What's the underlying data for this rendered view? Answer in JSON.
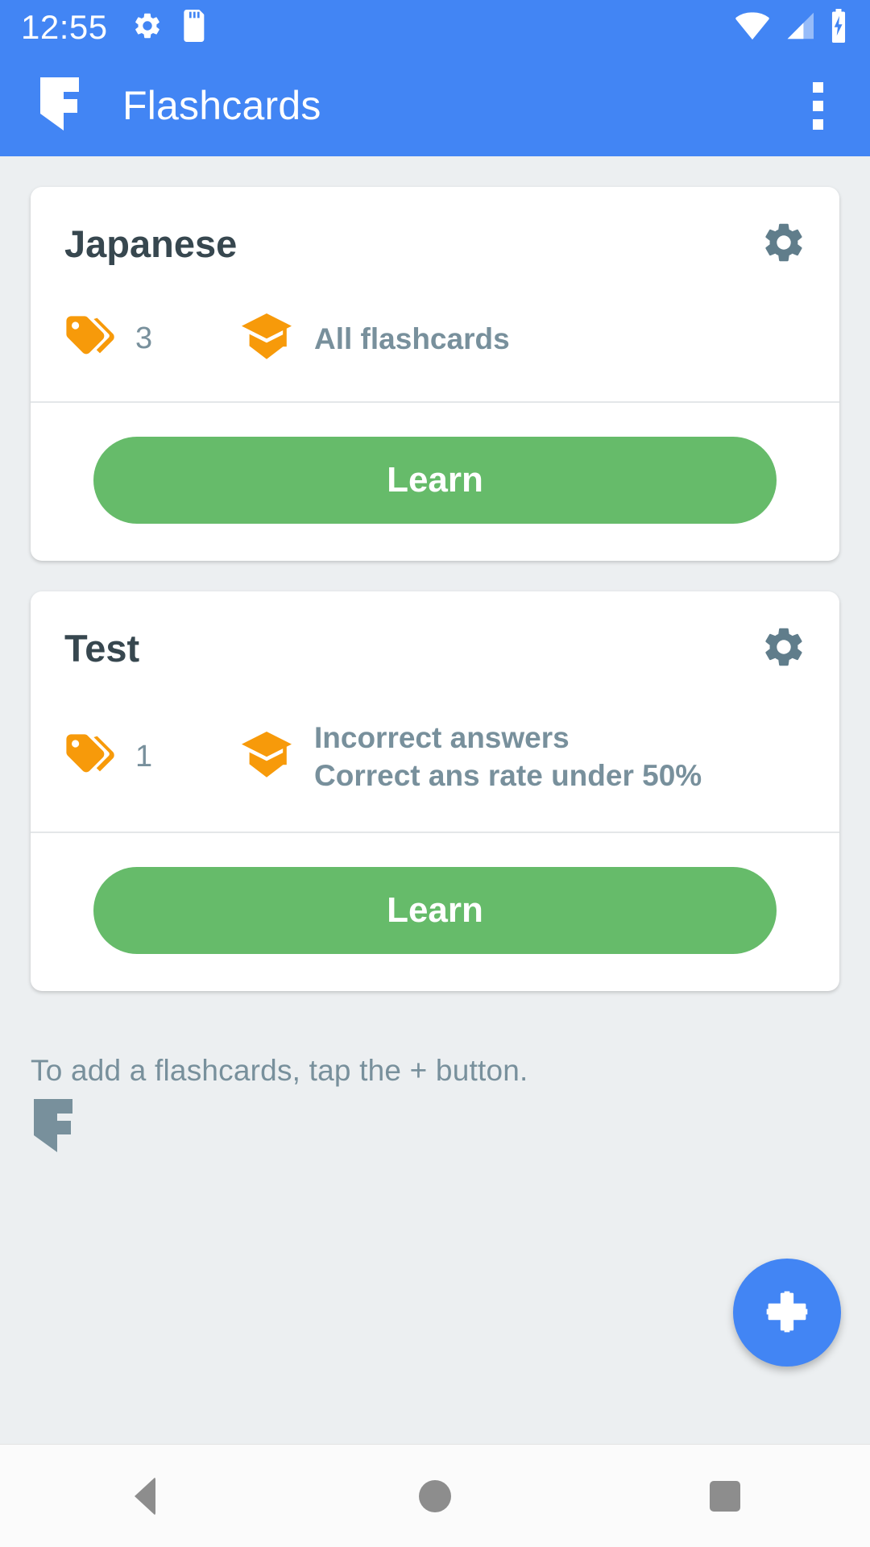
{
  "status_bar": {
    "time": "12:55",
    "left_icons": [
      "gear-icon",
      "sd-card-icon"
    ],
    "right_icons": [
      "wifi-icon",
      "cell-signal-icon",
      "battery-charging-icon"
    ]
  },
  "app_bar": {
    "logo": "flashcards-logo",
    "title": "Flashcards",
    "overflow": "overflow-menu-icon"
  },
  "colors": {
    "primary": "#4285f4",
    "learn_button": "#66bb6a",
    "accent_orange": "#f79a0a",
    "text_muted": "#78909c",
    "title": "#37474f",
    "background": "#eceff1"
  },
  "cards": [
    {
      "title": "Japanese",
      "gear": "settings-gear-icon",
      "tag_icon": "tags-icon",
      "tag_count": "3",
      "mode_icon": "graduation-cap-icon",
      "mode_lines": [
        "All flashcards"
      ],
      "learn_label": "Learn"
    },
    {
      "title": "Test",
      "gear": "settings-gear-icon",
      "tag_icon": "tags-icon",
      "tag_count": "1",
      "mode_icon": "graduation-cap-icon",
      "mode_lines": [
        "Incorrect answers",
        "Correct ans rate under 50%"
      ],
      "learn_label": "Learn"
    }
  ],
  "hint": {
    "text": "To add a flashcards, tap the + button.",
    "watermark": "flashcards-watermark-logo"
  },
  "fab": {
    "icon": "plus-icon",
    "label": "+"
  },
  "nav_bar": {
    "back": "back-triangle-icon",
    "home": "home-circle-icon",
    "recents": "recents-square-icon"
  }
}
